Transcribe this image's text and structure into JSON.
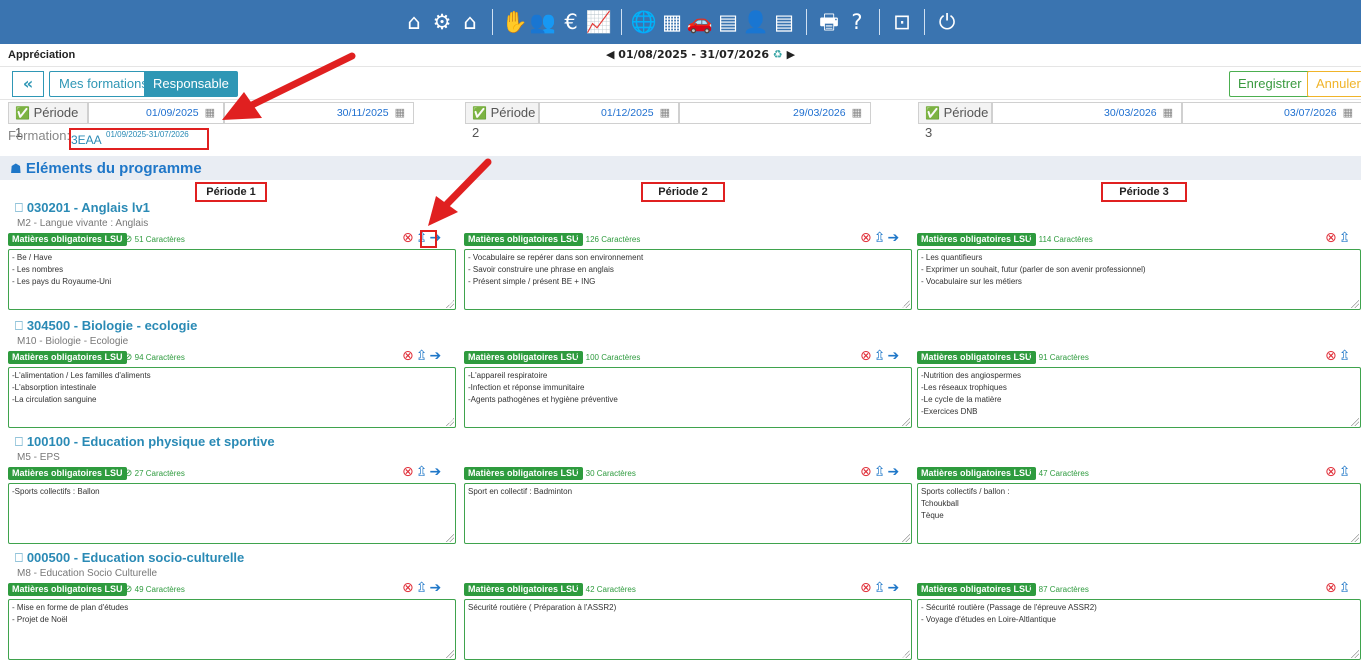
{
  "topbar": {
    "icons": [
      "home-icon",
      "cogs-icon",
      "building-icon",
      "handshake-icon",
      "people-icon",
      "euro-icon",
      "chart-line-icon",
      "globe-icon",
      "calendar-grid-icon",
      "car-icon",
      "id-card-icon",
      "user-grad-icon",
      "grade-sheet-icon",
      "print-icon",
      "help-icon",
      "expand-icon",
      "power-icon"
    ],
    "glyphs": [
      "⌂",
      "⚙",
      "⌂",
      "✋",
      "👥",
      "€",
      "📈",
      "🌐",
      "▦",
      "🚗",
      "▤",
      "👤",
      "▤",
      "🖶",
      "?",
      "⊡",
      "⏻"
    ]
  },
  "header": {
    "title": "Appréciation",
    "date_range": "◀ 01/08/2025  - 31/07/2026",
    "recycle_glyph": "♻",
    "next_glyph": "▶"
  },
  "toolbar": {
    "back_label": "«",
    "mes_formations_label": "Mes formations",
    "responsable_label": "Responsable",
    "save_label": "Enregistrer",
    "cancel_label": "Annuler"
  },
  "periods": [
    {
      "label": "Période 1",
      "start": "01/09/2025",
      "end": "30/11/2025"
    },
    {
      "label": "Période 2",
      "start": "01/12/2025",
      "end": "29/03/2026"
    },
    {
      "label": "Période 3",
      "start": "30/03/2026",
      "end": "03/07/2026"
    }
  ],
  "formation": {
    "label": "Formation:",
    "name": "3EAA",
    "dates": "01/09/2025-31/07/2026"
  },
  "section": {
    "title": "Eléments du programme"
  },
  "period_headers": [
    "Période 1",
    "Période 2",
    "Période 3"
  ],
  "badge_label": "Matières obligatoires LSU",
  "subjects": [
    {
      "title": "030201 - Anglais lv1",
      "subtitle": "M2 - Langue vivante : Anglais",
      "cols": [
        {
          "count": "51 Caractères",
          "text": "- Be / Have\n- Les nombres\n- Les pays du Royaume-Uni"
        },
        {
          "count": "126 Caractères",
          "text": "- Vocabulaire se repérer dans son environnement\n- Savoir construire une phrase en anglais\n- Présent simple / présent BE + ING"
        },
        {
          "count": "114 Caractères",
          "text": "- Les quantifieurs\n- Exprimer un souhait, futur (parler de son avenir professionnel)\n- Vocabulaire sur les métiers"
        }
      ]
    },
    {
      "title": "304500 - Biologie - ecologie",
      "subtitle": "M10 - Biologie - Ecologie",
      "cols": [
        {
          "count": "94 Caractères",
          "text": "-L'alimentation / Les familles d'aliments\n-L'absorption intestinale\n-La circulation sanguine"
        },
        {
          "count": "100 Caractères",
          "text": "-L'appareil respiratoire\n-Infection et réponse immunitaire\n-Agents pathogènes et hygiène préventive"
        },
        {
          "count": "91 Caractères",
          "text": "-Nutrition des angiospermes\n-Les réseaux trophiques\n-Le cycle de la matière\n-Exercices DNB"
        }
      ]
    },
    {
      "title": "100100 - Education physique et sportive",
      "subtitle": "M5 - EPS",
      "cols": [
        {
          "count": "27 Caractères",
          "text": "-Sports collectifs : Ballon"
        },
        {
          "count": "30 Caractères",
          "text": "Sport en collectif : Badminton"
        },
        {
          "count": "47 Caractères",
          "text": "Sports collectifs / ballon :\nTchoukball\nTèque"
        }
      ]
    },
    {
      "title": "000500 - Education socio-culturelle",
      "subtitle": "M8 - Education Socio Culturelle",
      "cols": [
        {
          "count": "49 Caractères",
          "text": "- Mise en forme de plan d'études\n- Projet de Noël"
        },
        {
          "count": "42 Caractères",
          "text": "Sécurité routière ( Préparation à l'ASSR2)"
        },
        {
          "count": "87 Caractères",
          "text": "- Sécurité routière (Passage de l'épreuve ASSR2)\n- Voyage d'études en Loire-Altlantique"
        }
      ]
    }
  ],
  "glyphs": {
    "check": "✅",
    "calendar": "▦",
    "bookmark": "⎕",
    "ok_circle": "⊘",
    "remove": "⊗",
    "upload": "⇫",
    "goto": "➔",
    "section": "☗"
  },
  "colors": {
    "topbar": "#3a74b0",
    "accent": "#2f97b5",
    "badge": "#2e9b3e",
    "annotation": "#e02020"
  }
}
